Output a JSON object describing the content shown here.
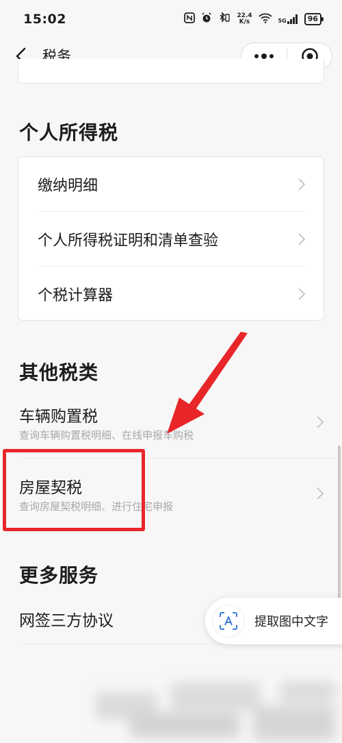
{
  "status_bar": {
    "time": "15:02",
    "net_speed_value": "22.4",
    "net_speed_unit": "K/s",
    "signal_label": "5G",
    "battery": "96"
  },
  "nav": {
    "title": "税务",
    "back_icon": "chevron-left-icon",
    "more_icon": "more-dots-icon",
    "close_icon": "target-close-icon"
  },
  "sections": {
    "personal_income_tax": {
      "title": "个人所得税",
      "items": [
        {
          "label": "缴纳明细"
        },
        {
          "label": "个人所得税证明和清单查验"
        },
        {
          "label": "个税计算器"
        }
      ]
    },
    "other_taxes": {
      "title": "其他税类",
      "items": [
        {
          "label": "车辆购置税",
          "desc": "查询车辆购置税明细、在线申报车购税"
        },
        {
          "label": "房屋契税",
          "desc": "查询房屋契税明细、进行住宅申报"
        }
      ]
    },
    "more_services": {
      "title": "更多服务",
      "items": [
        {
          "label": "网签三方协议"
        }
      ]
    }
  },
  "floating": {
    "extract_text_label": "提取图中文字",
    "extract_icon": "text-scan-icon"
  },
  "annotation": {
    "highlight_color": "#e8262a"
  }
}
